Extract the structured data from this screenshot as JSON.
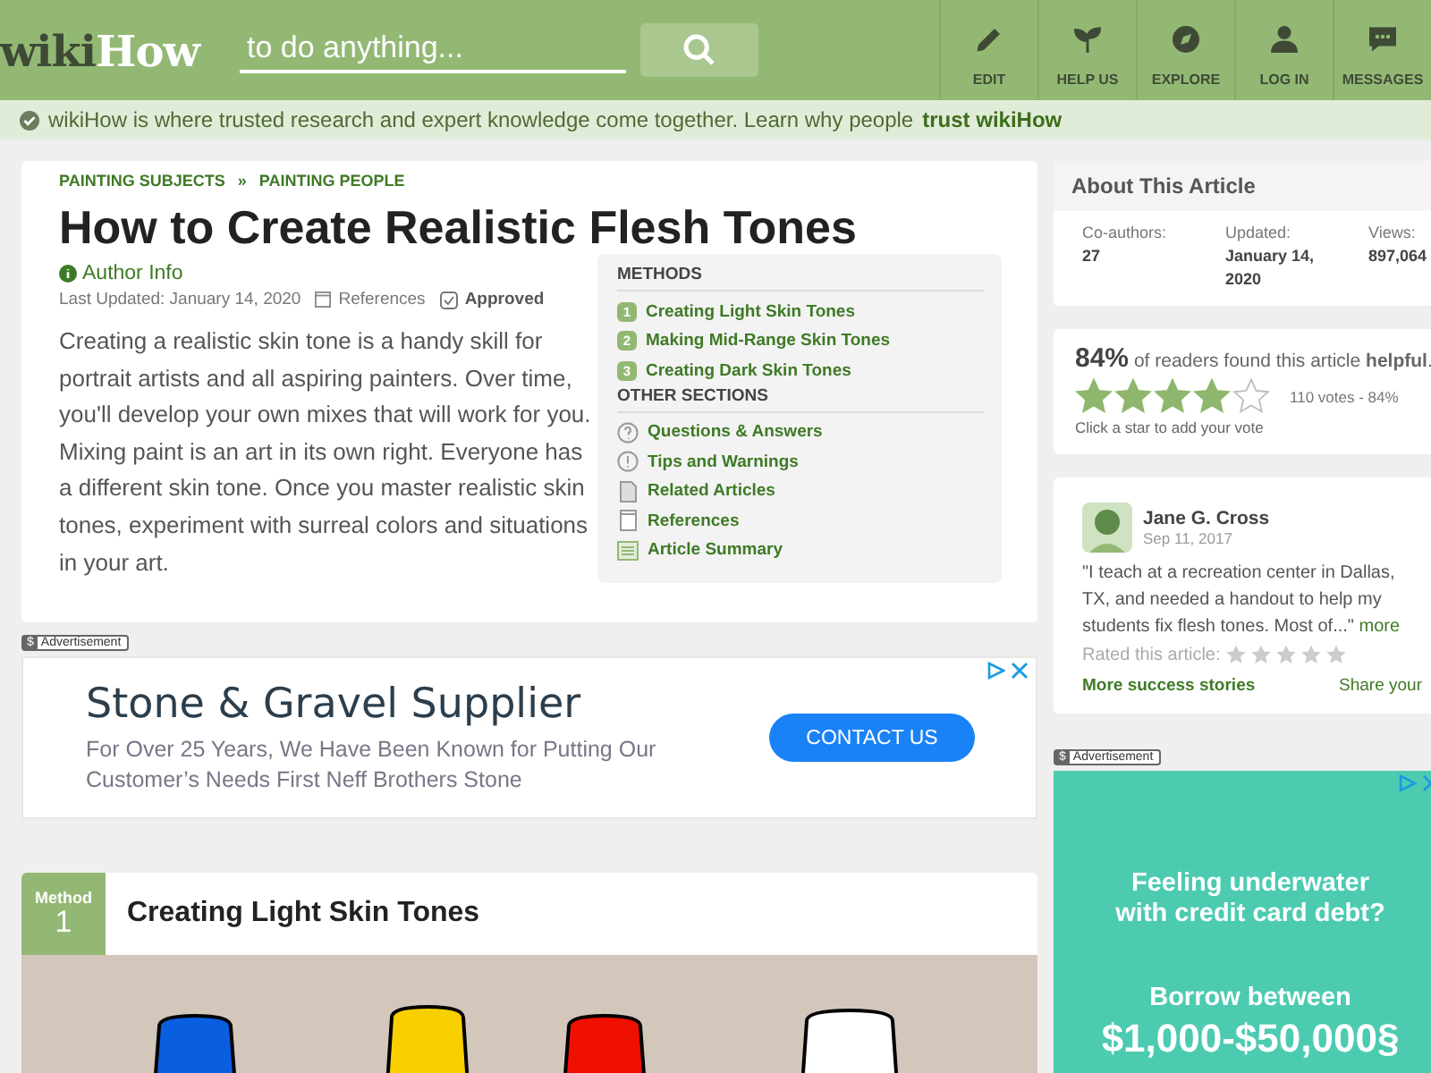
{
  "header": {
    "logo": {
      "part_1": "wiki",
      "part_2": "How"
    },
    "search": {
      "placeholder": "to do anything..."
    },
    "nav": [
      {
        "kind": "edit",
        "label": "EDIT"
      },
      {
        "kind": "sprout",
        "label": "HELP US"
      },
      {
        "kind": "compass",
        "label": "EXPLORE"
      },
      {
        "kind": "user",
        "label": "LOG IN"
      },
      {
        "kind": "chat",
        "label": "MESSAGES"
      }
    ]
  },
  "trust_bar": {
    "text": "wikiHow is where trusted research and expert knowledge come together. Learn why people",
    "link": "trust wikiHow"
  },
  "article": {
    "breadcrumbs": [
      "PAINTING SUBJECTS",
      "PAINTING PEOPLE"
    ],
    "separator": "»",
    "title": "How to Create Realistic Flesh Tones",
    "author_info": "Author Info",
    "last_updated": "Last Updated: January 14, 2020",
    "references": "References",
    "approved": "Approved",
    "intro": "Creating a realistic skin tone is a handy skill for portrait artists and all aspiring painters. Over time, you'll develop your own mixes that will work for you. Mixing paint is an art in its own right. Everyone has a different skin tone. Once you master realistic skin tones, experiment with surreal colors and situations in your art.",
    "toc": {
      "methods_heading": "METHODS",
      "methods": [
        {
          "number": "1",
          "label": "Creating Light Skin Tones"
        },
        {
          "number": "2",
          "label": "Making Mid-Range Skin Tones"
        },
        {
          "number": "3",
          "label": "Creating Dark Skin Tones"
        }
      ],
      "other_heading": "OTHER SECTIONS",
      "other": [
        {
          "kind": "question",
          "label": "Questions & Answers"
        },
        {
          "kind": "warning",
          "label": "Tips and Warnings"
        },
        {
          "kind": "document",
          "label": "Related Articles"
        },
        {
          "kind": "page",
          "label": "References"
        },
        {
          "kind": "summary",
          "label": "Article Summary"
        }
      ]
    }
  },
  "ad": {
    "label_icon": "$",
    "label": "Advertisement",
    "title": "Stone & Gravel Supplier",
    "body": "For Over 25 Years, We Have Been Known for Putting Our Customer’s Needs First Neff Brothers Stone",
    "button": "CONTACT US"
  },
  "method": {
    "tag": "Method",
    "number": "1",
    "title": "Creating Light Skin Tones"
  },
  "sidebar": {
    "about": {
      "title": "About This Article",
      "stats": [
        {
          "label": "Co-authors:",
          "value": "27"
        },
        {
          "label": "Updated:",
          "value": "January 14, 2020"
        },
        {
          "label": "Views:",
          "value": "897,064"
        }
      ]
    },
    "helpful": {
      "percent": "84%",
      "text": "of readers found this article **helpful**.",
      "stars": 4,
      "votes": "110 votes - 84%",
      "hint": "Click a star to add your vote"
    },
    "story": {
      "name": "Jane G. Cross",
      "date": "Sep 11, 2017",
      "quote": "\"I teach at a recreation center in Dallas, TX, and needed a handout to help my students fix flesh tones. Most of...\"",
      "more": "more",
      "rated": "Rated this article:",
      "more_stories": "More success stories",
      "share": "Share your"
    },
    "ad": {
      "label_icon": "$",
      "label": "Advertisement",
      "line_1": "Feeling underwater with credit card debt?",
      "line_2": "Borrow between",
      "line_3": "$1,000-$50,000§"
    }
  }
}
